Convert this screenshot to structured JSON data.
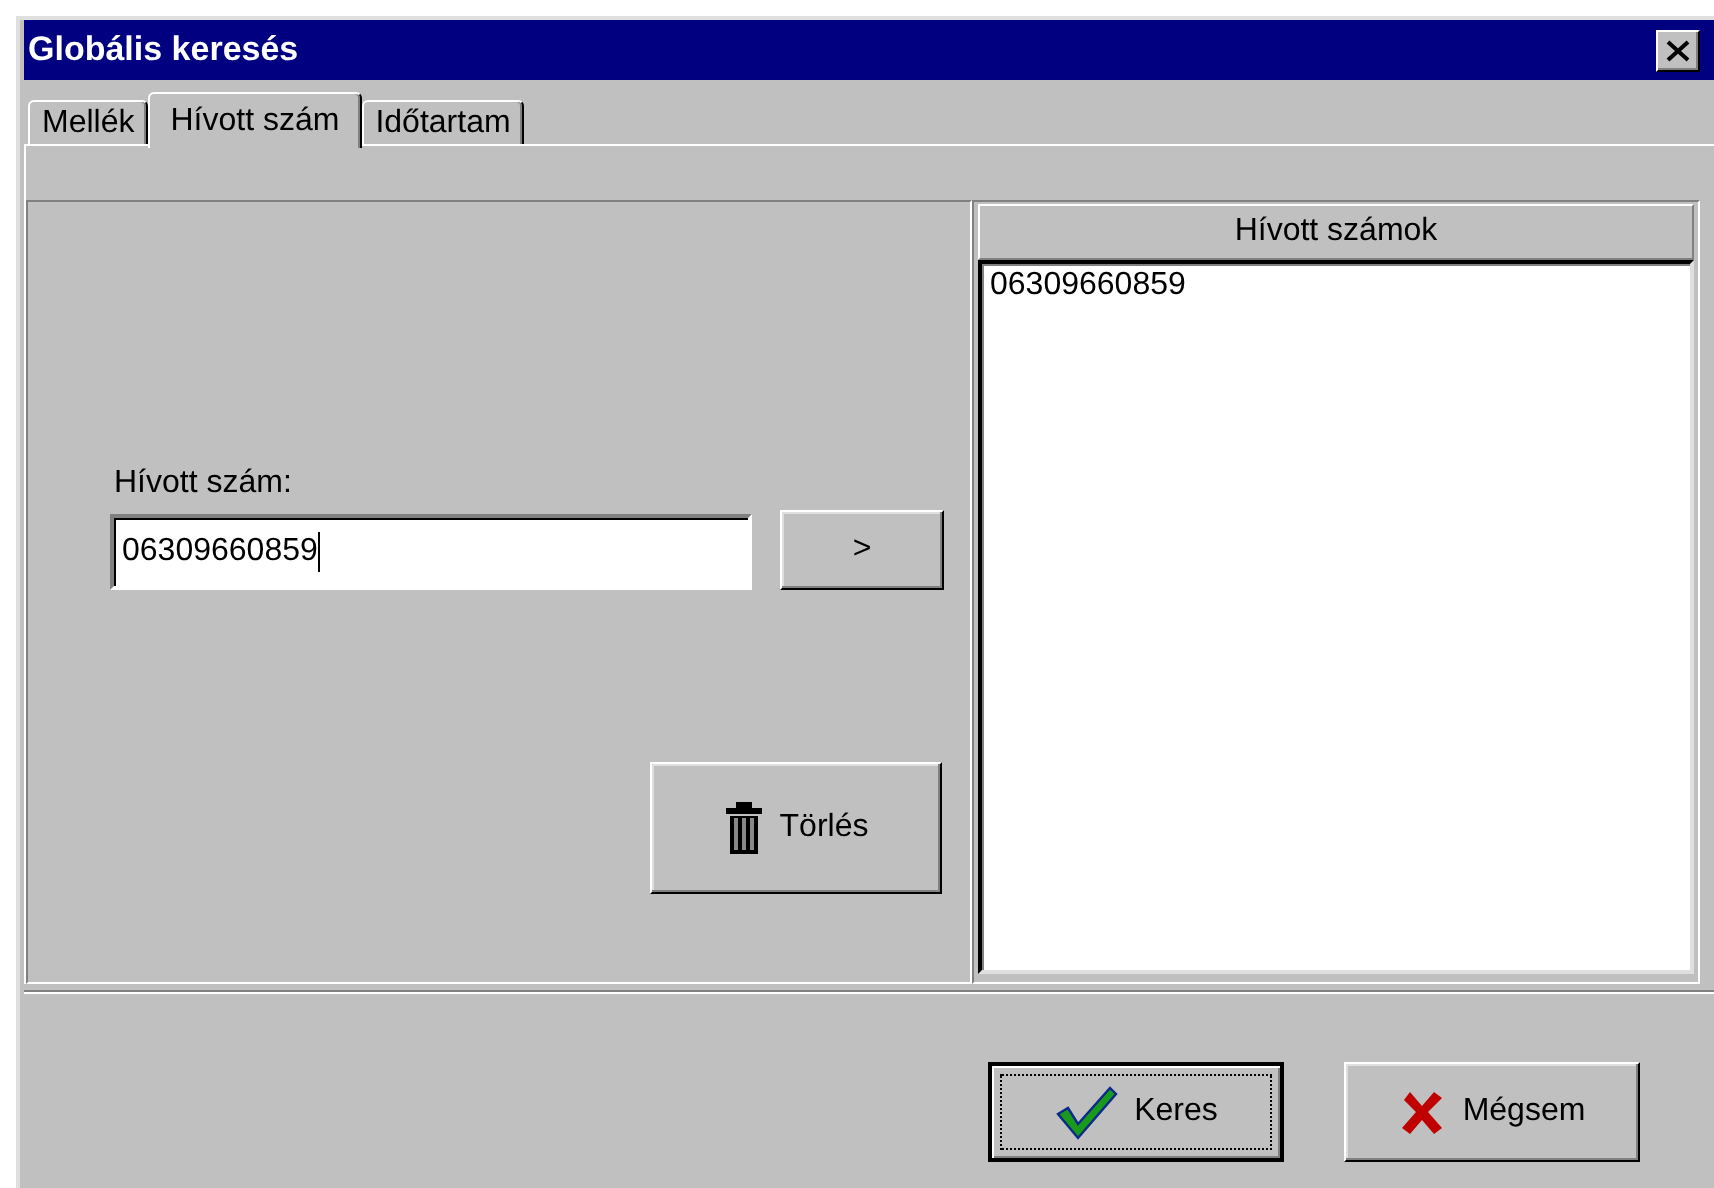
{
  "window": {
    "title": "Globális keresés"
  },
  "tabs": [
    {
      "label": "Mellék",
      "selected": false
    },
    {
      "label": "Hívott szám",
      "selected": true
    },
    {
      "label": "Időtartam",
      "selected": false
    }
  ],
  "number_field": {
    "label": "Hívott szám:",
    "value": "06309660859"
  },
  "add_button": {
    "label": ">"
  },
  "delete_button": {
    "label": "Törlés"
  },
  "called_numbers": {
    "header": "Hívott számok",
    "items": [
      "06309660859"
    ]
  },
  "buttons": [
    {
      "label": "Keres",
      "kind": "ok",
      "default": true
    },
    {
      "label": "Mégsem",
      "kind": "cancel",
      "default": false
    }
  ]
}
